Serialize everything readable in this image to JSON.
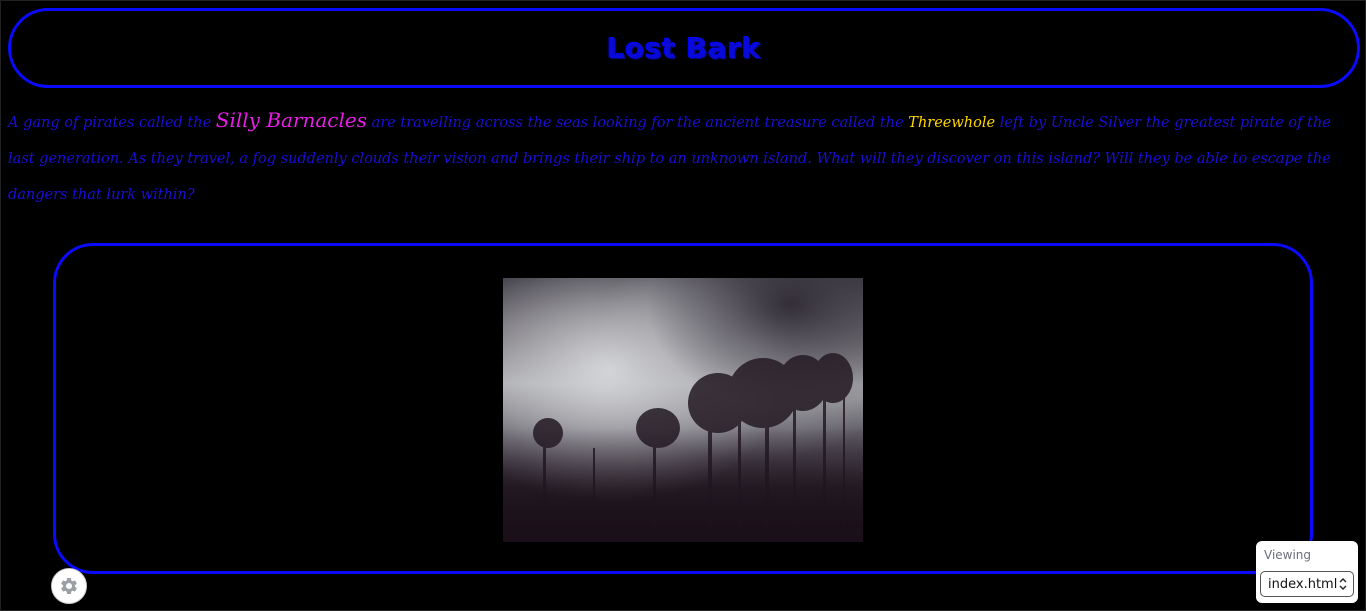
{
  "title": "Lost Bark",
  "story": {
    "before_crew": "A gang of pirates called the ",
    "crew_name": "Silly Barnacles",
    "before_treasure": " are travelling across the seas looking for the ancient treasure called the ",
    "treasure_name": "Threewhole",
    "after_treasure": " left by Uncle Silver the greatest pirate of the last generation. As they travel, a fog suddenly clouds their vision and brings their ship to an unknown island. What will they discover on this island? Will they be able to escape the dangers that lurk within?"
  },
  "image": {
    "description_icon": "foggy-forest-image"
  },
  "settings": {
    "icon": "gear-icon"
  },
  "viewing": {
    "label": "Viewing",
    "selected": "index.html"
  },
  "colors": {
    "background": "#000000",
    "border": "#0a0aff",
    "text": "#1a0dd6",
    "crew_highlight": "#e61ee6",
    "treasure_highlight": "#ffd700"
  }
}
